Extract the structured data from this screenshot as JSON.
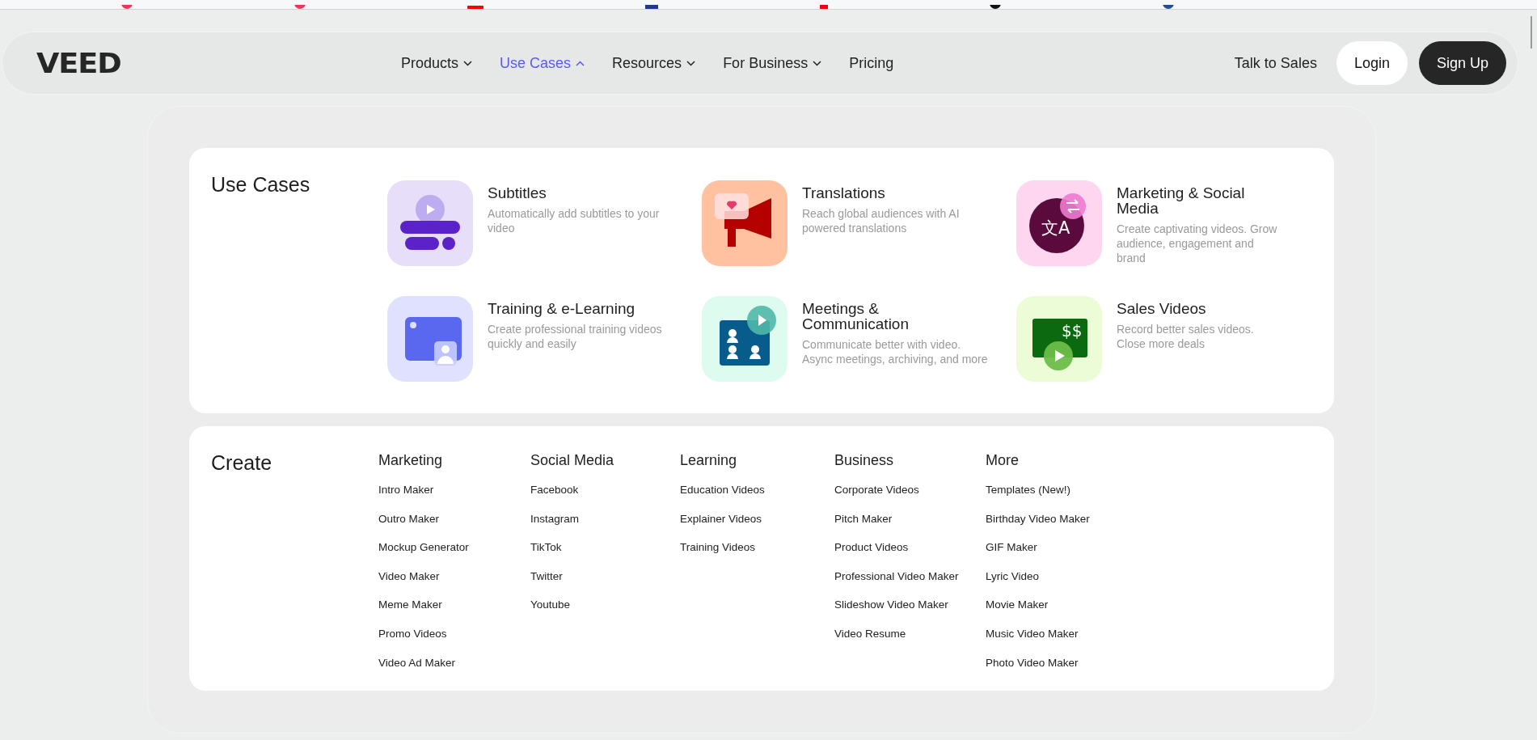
{
  "logo": "VEED",
  "nav": {
    "items": [
      {
        "label": "Products",
        "kind": "dropdown",
        "selected": false
      },
      {
        "label": "Use Cases",
        "kind": "dropdown",
        "selected": true
      },
      {
        "label": "Resources",
        "kind": "dropdown",
        "selected": false
      },
      {
        "label": "For Business",
        "kind": "dropdown",
        "selected": false
      },
      {
        "label": "Pricing",
        "kind": "link",
        "selected": false
      }
    ],
    "talk_to_sales": "Talk to Sales",
    "login": "Login",
    "sign_up": "Sign Up"
  },
  "use_cases": {
    "title": "Use Cases",
    "items": [
      {
        "title": "Subtitles",
        "description": "Automatically add subtitles to your video"
      },
      {
        "title": "Translations",
        "description": "Reach global audiences with AI powered translations"
      },
      {
        "title": "Marketing & Social Media",
        "description": "Create captivating videos. Grow audience, engagement and brand",
        "icon_text": "文A"
      },
      {
        "title": "Training & e-Learning",
        "description": "Create professional training videos quickly and easily"
      },
      {
        "title": "Meetings & Communication",
        "description": "Communicate better with video. Async meetings, archiving, and more"
      },
      {
        "title": "Sales Videos",
        "description": "Record better sales videos. Close more deals",
        "icon_text": "$$"
      }
    ]
  },
  "create": {
    "title": "Create",
    "columns": [
      {
        "heading": "Marketing",
        "links": [
          "Intro Maker",
          "Outro Maker",
          "Mockup Generator",
          "Video Maker",
          "Meme Maker",
          "Promo Videos",
          "Video Ad Maker"
        ]
      },
      {
        "heading": "Social Media",
        "links": [
          "Facebook",
          "Instagram",
          "TikTok",
          "Twitter",
          "Youtube"
        ]
      },
      {
        "heading": "Learning",
        "links": [
          "Education Videos",
          "Explainer Videos",
          "Training Videos"
        ]
      },
      {
        "heading": "Business",
        "links": [
          "Corporate Videos",
          "Pitch Maker",
          "Product Videos",
          "Professional Video Maker",
          "Slideshow Video Maker",
          "Video Resume"
        ]
      },
      {
        "heading": "More",
        "links": [
          "Templates (New!)",
          "Birthday Video Maker",
          "GIF Maker",
          "Lyric Video",
          "Movie Maker",
          "Music Video Maker",
          "Photo Video Maker"
        ]
      }
    ]
  }
}
